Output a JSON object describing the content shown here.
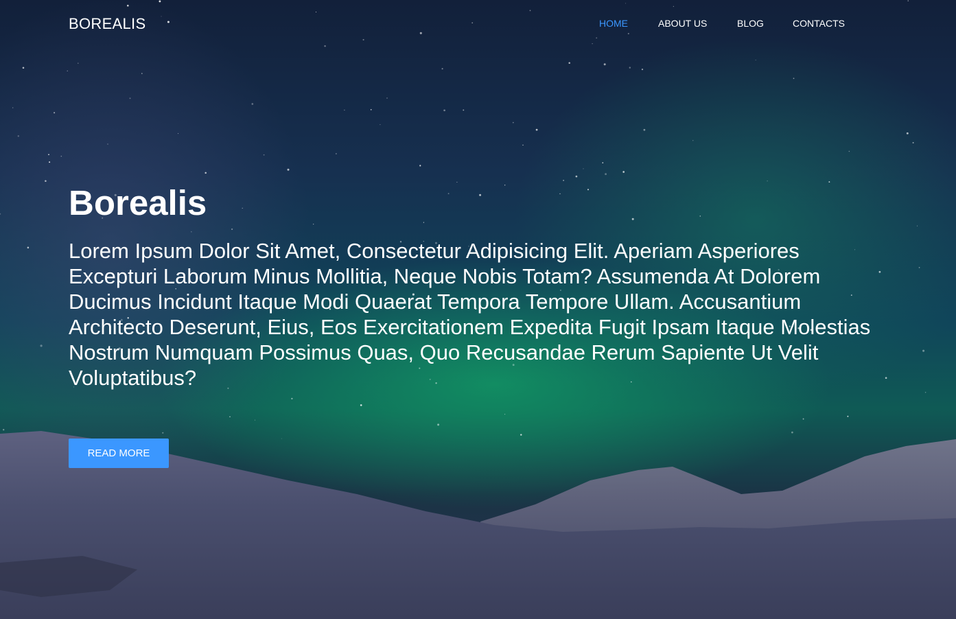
{
  "brand": {
    "name": "BOREALIS"
  },
  "nav": {
    "items": [
      {
        "label": "HOME",
        "active": true
      },
      {
        "label": "ABOUT US",
        "active": false
      },
      {
        "label": "BLOG",
        "active": false
      },
      {
        "label": "CONTACTS",
        "active": false
      }
    ]
  },
  "hero": {
    "title": "Borealis",
    "text": "Lorem Ipsum Dolor Sit Amet, Consectetur Adipisicing Elit. Aperiam Asperiores Excepturi Laborum Minus Mollitia, Neque Nobis Totam? Assumenda At Dolorem Ducimus Incidunt Itaque Modi Quaerat Tempora Tempore Ullam. Accusantium Architecto Deserunt, Eius, Eos Exercitationem Expedita Fugit Ipsam Itaque Molestias Nostrum Numquam Possimus Quas, Quo Recusandae Rerum Sapiente Ut Velit Voluptatibus?",
    "button_label": "READ MORE"
  },
  "colors": {
    "accent": "#3b97ff",
    "text": "#ffffff"
  }
}
